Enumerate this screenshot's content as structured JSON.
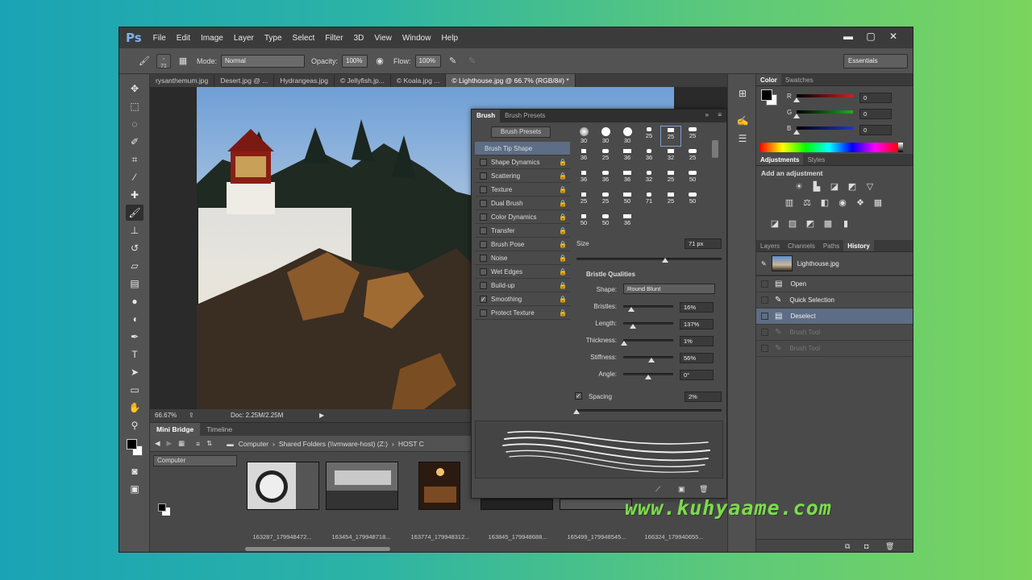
{
  "app": {
    "logo": "Ps"
  },
  "menu": [
    "File",
    "Edit",
    "Image",
    "Layer",
    "Type",
    "Select",
    "Filter",
    "3D",
    "View",
    "Window",
    "Help"
  ],
  "window_controls": {
    "minimize": "▬",
    "maximize": "▢",
    "close": "✕"
  },
  "options_bar": {
    "brush_size": "71",
    "mode_label": "Mode:",
    "mode_value": "Normal",
    "opacity_label": "Opacity:",
    "opacity_value": "100%",
    "flow_label": "Flow:",
    "flow_value": "100%",
    "workspace": "Essentials"
  },
  "doc_tabs": [
    "rysanthemum.jpg",
    "Desert.jpg @ ...",
    "Hydrangeas.jpg",
    "© Jellyfish.jp...",
    "© Koala.jpg ...",
    "© Lighthouse.jpg @ 66.7% (RGB/8#) *"
  ],
  "status": {
    "zoom": "66.67%",
    "doc": "Doc: 2.25M/2.25M"
  },
  "mini_bridge": {
    "tabs": [
      "Mini Bridge",
      "Timeline"
    ],
    "path": [
      "Computer",
      "Shared Folders (\\\\vmware-host) (Z:)",
      "HOST C"
    ],
    "location": "Computer",
    "thumbnails": [
      "163287_179948472...",
      "163454_179948718...",
      "163774_179948312...",
      "163845_179948688...",
      "165499_179948545...",
      "166324_179940655..."
    ]
  },
  "brush_panel": {
    "tabs": [
      "Brush",
      "Brush Presets"
    ],
    "presets_button": "Brush Presets",
    "options": [
      {
        "label": "Brush Tip Shape",
        "checked": false,
        "selected": true,
        "checkbox": false
      },
      {
        "label": "Shape Dynamics",
        "checked": false
      },
      {
        "label": "Scattering",
        "checked": false
      },
      {
        "label": "Texture",
        "checked": false
      },
      {
        "label": "Dual Brush",
        "checked": false
      },
      {
        "label": "Color Dynamics",
        "checked": false
      },
      {
        "label": "Transfer",
        "checked": false
      },
      {
        "label": "Brush Pose",
        "checked": false
      },
      {
        "label": "Noise",
        "checked": false
      },
      {
        "label": "Wet Edges",
        "checked": false
      },
      {
        "label": "Build-up",
        "checked": false
      },
      {
        "label": "Smoothing",
        "checked": true
      },
      {
        "label": "Protect Texture",
        "checked": false
      }
    ],
    "tip_sizes": [
      "30",
      "30",
      "30",
      "25",
      "25",
      "25",
      "36",
      "25",
      "36",
      "36",
      "32",
      "25",
      "36",
      "36",
      "36",
      "32",
      "25",
      "50",
      "25",
      "25",
      "50",
      "71",
      "25",
      "50",
      "50",
      "50",
      "36"
    ],
    "size_label": "Size",
    "size_value": "71 px",
    "bristle_title": "Bristle Qualities",
    "shape_label": "Shape:",
    "shape_value": "Round Blunt",
    "bristle_fields": [
      {
        "label": "Bristles:",
        "value": "16%",
        "level": 0.16
      },
      {
        "label": "Length:",
        "value": "137%",
        "level": 0.2
      },
      {
        "label": "Thickness:",
        "value": "1%",
        "level": 0.02
      },
      {
        "label": "Stiffness:",
        "value": "56%",
        "level": 0.56
      },
      {
        "label": "Angle:",
        "value": "0°",
        "level": 0.5
      }
    ],
    "spacing_label": "Spacing",
    "spacing_value": "2%",
    "spacing_checked": true
  },
  "color_panel": {
    "tabs": [
      "Color",
      "Swatches"
    ],
    "channels": [
      {
        "label": "R",
        "value": "0",
        "color": "#cc2222"
      },
      {
        "label": "G",
        "value": "0",
        "color": "#22aa22"
      },
      {
        "label": "B",
        "value": "0",
        "color": "#2233cc"
      }
    ]
  },
  "adjustments_panel": {
    "tabs": [
      "Adjustments",
      "Styles"
    ],
    "title": "Add an adjustment"
  },
  "history_panel": {
    "tabs": [
      "Layers",
      "Channels",
      "Paths",
      "History"
    ],
    "snapshot": "Lighthouse.jpg",
    "states": [
      {
        "label": "Open",
        "dim": false,
        "selected": false
      },
      {
        "label": "Quick Selection",
        "dim": false,
        "selected": false
      },
      {
        "label": "Deselect",
        "dim": false,
        "selected": true
      },
      {
        "label": "Brush Tool",
        "dim": true,
        "selected": false
      },
      {
        "label": "Brush Tool",
        "dim": true,
        "selected": false
      }
    ]
  },
  "watermark": "www.kuhyaame.com"
}
